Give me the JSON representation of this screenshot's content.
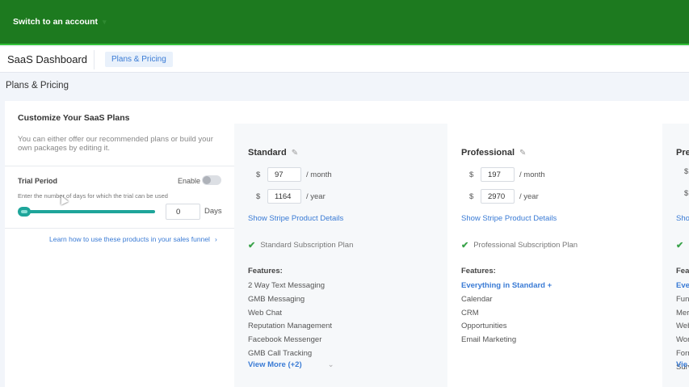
{
  "topbar": {
    "switch_label": "Switch to an account",
    "caret": "▾"
  },
  "header": {
    "title": "SaaS Dashboard",
    "tab": "Plans & Pricing"
  },
  "page": {
    "title": "Plans & Pricing"
  },
  "left": {
    "heading": "Customize Your SaaS Plans",
    "description": "You can either offer our recommended plans or build your own packages by editing it.",
    "trial_label": "Trial Period",
    "enable_label": "Enable",
    "trial_help": "Enter the number of days for which the trial can be used",
    "trial_days": "0",
    "days_label": "Days",
    "learn_link": "Learn how to use these products in your sales funnel",
    "learn_chevron": "›"
  },
  "plans": [
    {
      "name": "Standard",
      "currency": "$",
      "monthly": "97",
      "monthly_suffix": "/ month",
      "yearly": "1164",
      "yearly_suffix": "/ year",
      "stripe_link": "Show Stripe Product Details",
      "subscription": "Standard Subscription Plan",
      "features_title": "Features:",
      "features": [
        "2 Way Text Messaging",
        "GMB Messaging",
        "Web Chat",
        "Reputation Management",
        "Facebook Messenger",
        "GMB Call Tracking"
      ],
      "view_more": "View More (+2)",
      "view_more_chevron": "⌄"
    },
    {
      "name": "Professional",
      "currency": "$",
      "monthly": "197",
      "monthly_suffix": "/ month",
      "yearly": "2970",
      "yearly_suffix": "/ year",
      "stripe_link": "Show Stripe Product Details",
      "subscription": "Professional Subscription Plan",
      "features_title": "Features:",
      "features_highlight": "Everything in Standard +",
      "features": [
        "Calendar",
        "CRM",
        "Opportunities",
        "Email Marketing"
      ]
    },
    {
      "name": "Pre",
      "currency": "$",
      "stripe_link": "Sho",
      "features_title": "Fea",
      "features_highlight": "Eve",
      "features": [
        "Fun",
        "Mer",
        "Web",
        "Wor",
        "Forr",
        "Surv"
      ],
      "view_more": "Vie"
    }
  ],
  "icons": {
    "pencil": "✎",
    "check": "✔"
  }
}
